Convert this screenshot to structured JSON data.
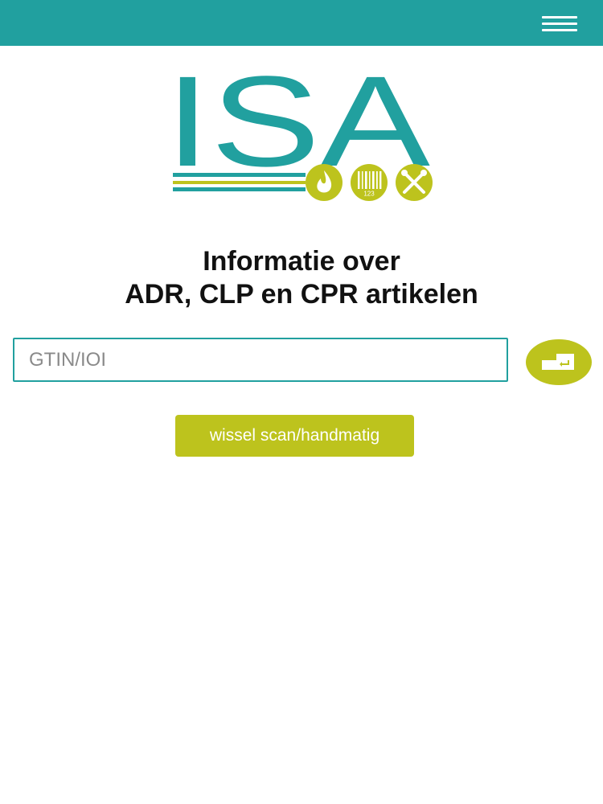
{
  "app": {
    "logo_text": "ISA",
    "logo_badge_text": "123"
  },
  "header": {
    "menu_icon": "hamburger-menu-icon"
  },
  "main": {
    "headline_line1": "Informatie over",
    "headline_line2": "ADR, CLP en CPR artikelen",
    "search": {
      "placeholder": "GTIN/IOI",
      "value": ""
    },
    "submit_icon": "enter-key-icon",
    "toggle_label": "wissel scan/handmatig"
  },
  "colors": {
    "brand_teal": "#21a09f",
    "accent_lime": "#bdc31d",
    "background": "#ffffff",
    "headline": "#111111"
  }
}
